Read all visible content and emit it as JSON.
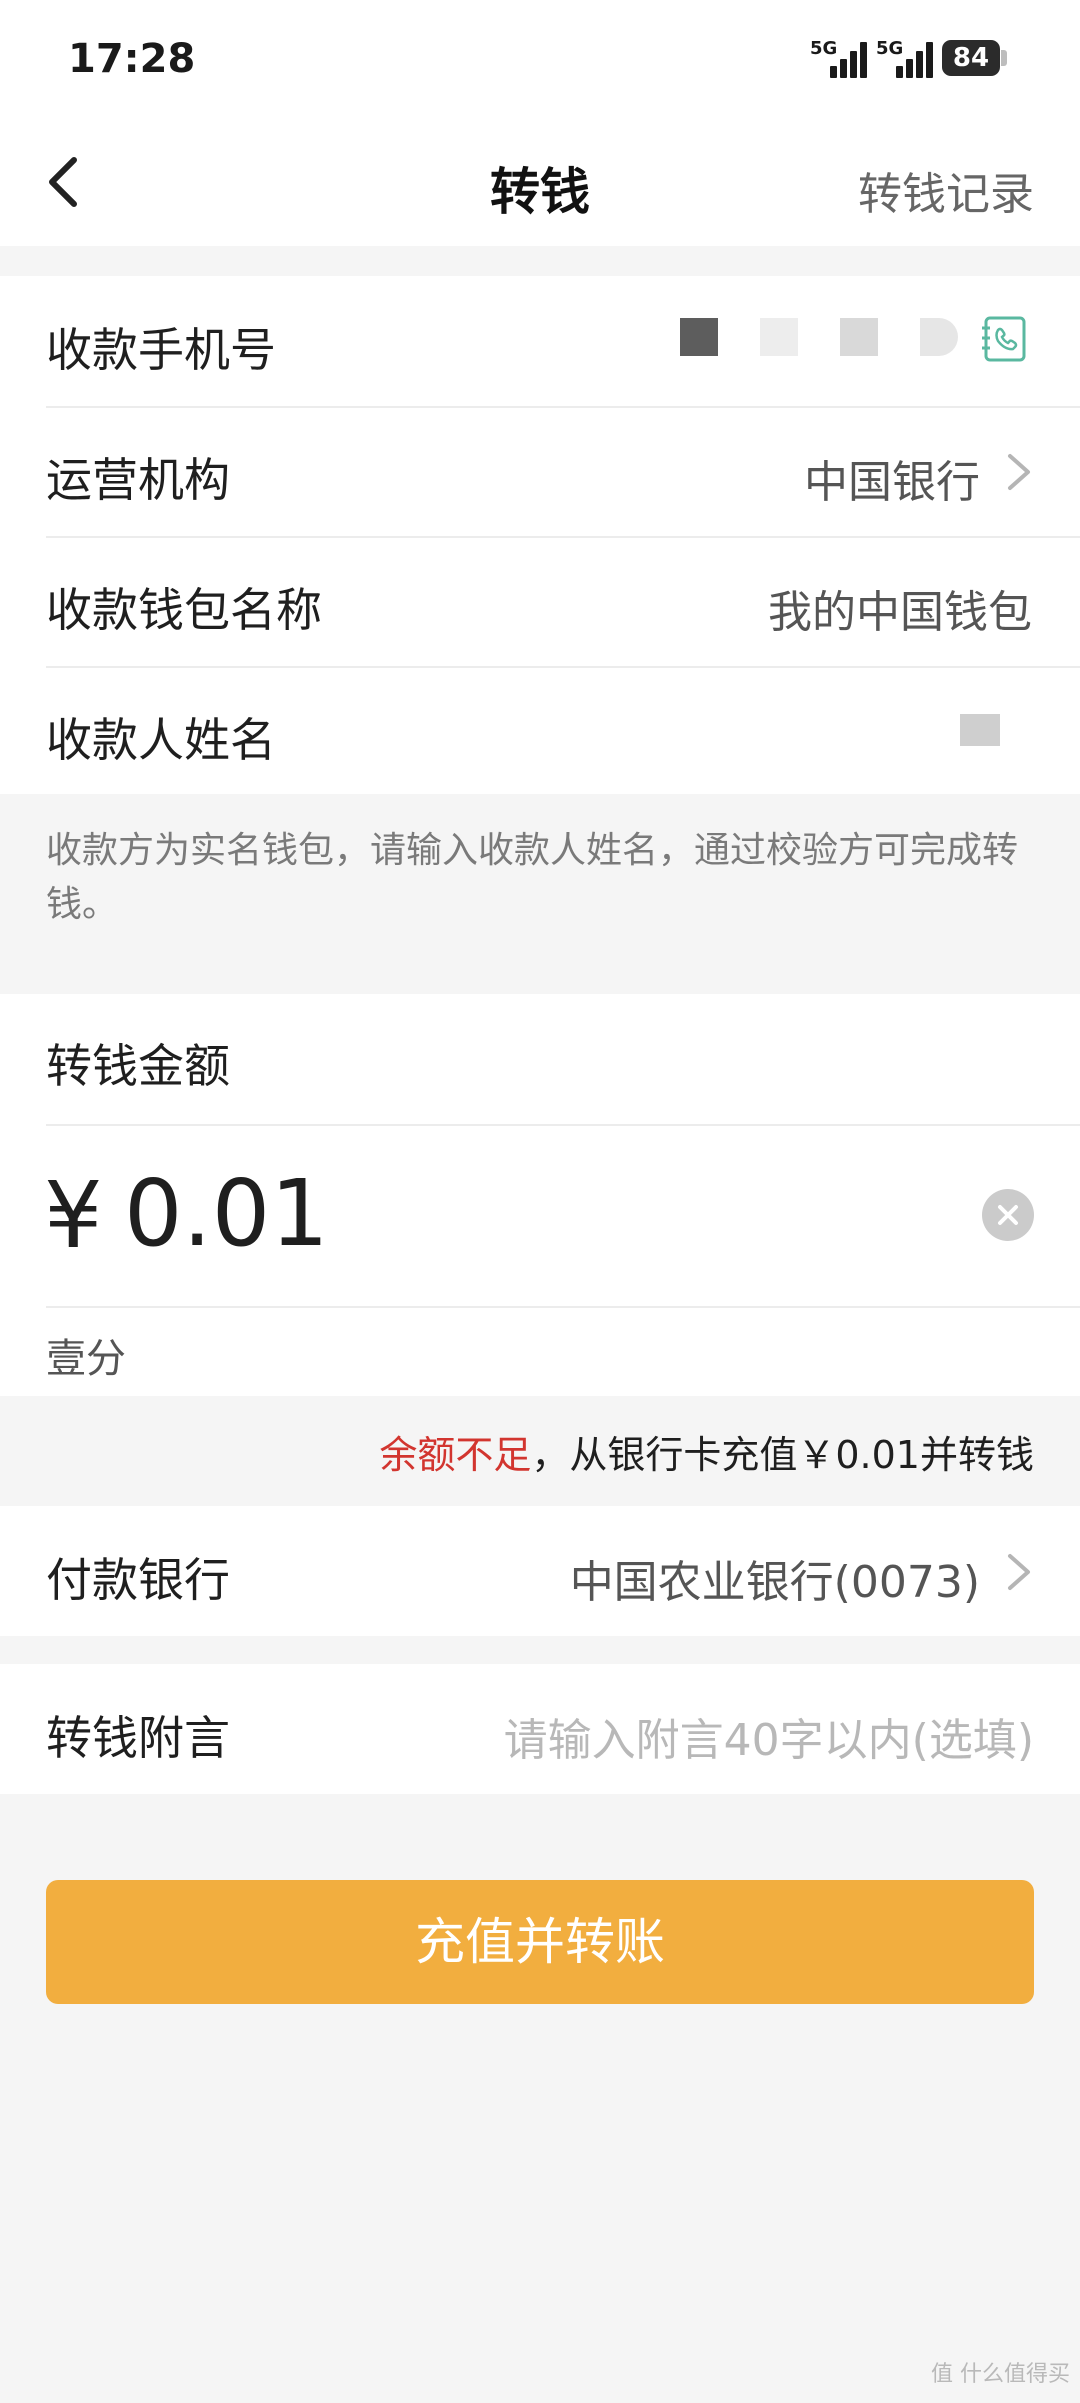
{
  "status_bar": {
    "time": "17:28",
    "signal_1_label": "5G",
    "signal_2_label": "5G",
    "battery": "84"
  },
  "nav": {
    "title": "转钱",
    "record_link": "转钱记录",
    "back_icon": "chevron-left-icon"
  },
  "recipient": {
    "phone_label": "收款手机号",
    "institution_label": "运营机构",
    "institution_value": "中国银行",
    "wallet_name_label": "收款钱包名称",
    "wallet_name_value": "我的中国钱包",
    "payee_name_label": "收款人姓名",
    "contacts_icon": "phone-book-icon"
  },
  "hint_text": "收款方为实名钱包，请输入收款人姓名，通过校验方可完成转钱。",
  "amount": {
    "label": "转钱金额",
    "symbol": "¥",
    "value": "0.01",
    "in_words": "壹分",
    "clear_icon": "clear-icon"
  },
  "balance_notice": {
    "warning": "余额不足",
    "detail": "，从银行卡充值￥0.01并转钱"
  },
  "payment": {
    "bank_label": "付款银行",
    "bank_value": "中国农业银行(0073)"
  },
  "note": {
    "label": "转钱附言",
    "placeholder": "请输入附言40字以内(选填)"
  },
  "submit_button": "充值并转账",
  "watermark": "值 什么值得买",
  "colors": {
    "primary_button": "#f2ae3f",
    "warning": "#d2352f",
    "contacts_icon": "#5ab8a0"
  }
}
